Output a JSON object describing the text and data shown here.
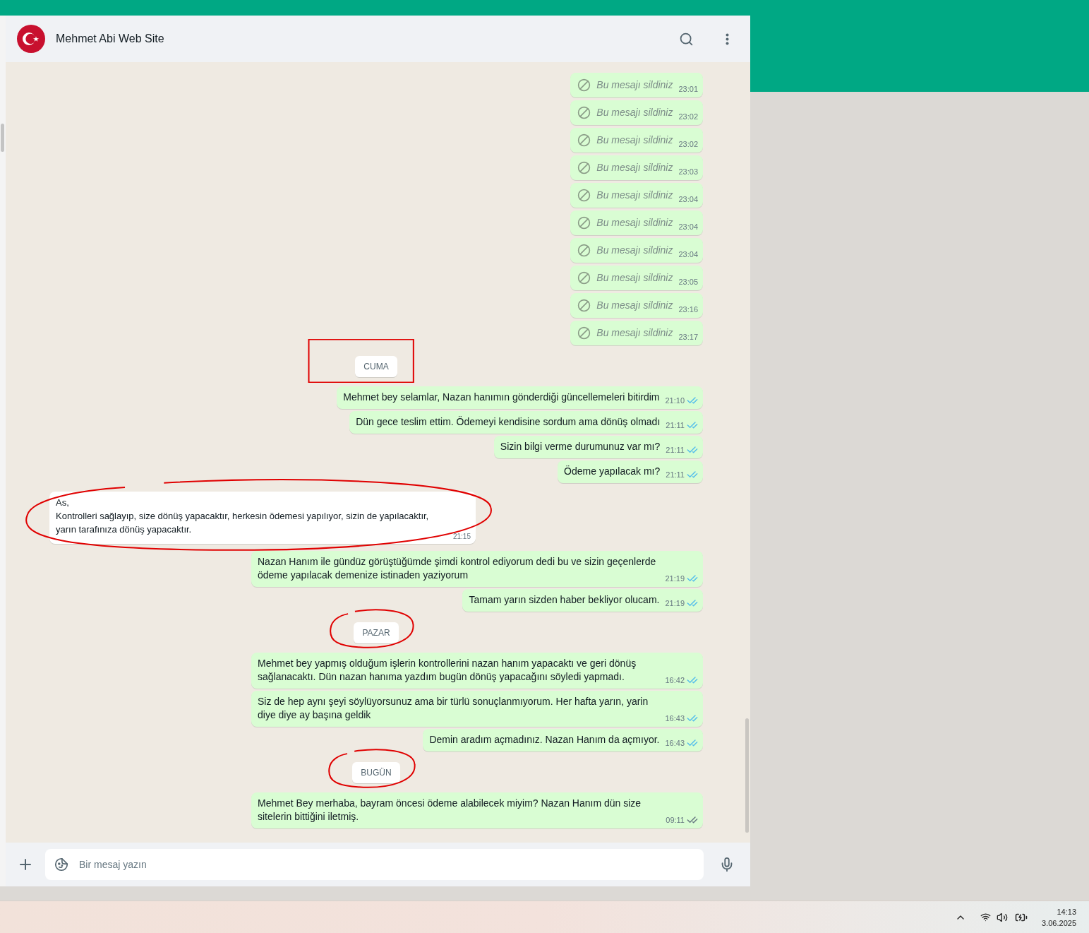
{
  "header": {
    "title": "Mehmet Abi Web Site"
  },
  "messages": [
    {
      "kind": "deleted",
      "text": "Bu mesajı sildiniz",
      "time": "23:01"
    },
    {
      "kind": "deleted",
      "text": "Bu mesajı sildiniz",
      "time": "23:02"
    },
    {
      "kind": "deleted",
      "text": "Bu mesajı sildiniz",
      "time": "23:02"
    },
    {
      "kind": "deleted",
      "text": "Bu mesajı sildiniz",
      "time": "23:03"
    },
    {
      "kind": "deleted",
      "text": "Bu mesajı sildiniz",
      "time": "23:04"
    },
    {
      "kind": "deleted",
      "text": "Bu mesajı sildiniz",
      "time": "23:04"
    },
    {
      "kind": "deleted",
      "text": "Bu mesajı sildiniz",
      "time": "23:04"
    },
    {
      "kind": "deleted",
      "text": "Bu mesajı sildiniz",
      "time": "23:05"
    },
    {
      "kind": "deleted",
      "text": "Bu mesajı sildiniz",
      "time": "23:16"
    },
    {
      "kind": "deleted",
      "text": "Bu mesajı sildiniz",
      "time": "23:17"
    },
    {
      "kind": "date",
      "text": "CUMA",
      "boxed": true,
      "circled": false
    },
    {
      "kind": "out",
      "text": "Mehmet bey selamlar, Nazan hanımın gönderdiği güncellemeleri bitirdim",
      "time": "21:10",
      "read": true
    },
    {
      "kind": "out",
      "text": "Dün gece teslim ettim. Ödemeyi kendisine sordum ama dönüş olmadı",
      "time": "21:11",
      "read": true
    },
    {
      "kind": "out",
      "text": "Sizin bilgi verme durumunuz var mı?",
      "time": "21:11",
      "read": true
    },
    {
      "kind": "out",
      "text": "Ödeme yapılacak mı?",
      "time": "21:11",
      "read": true
    },
    {
      "kind": "in",
      "text": "As,\nKontrolleri sağlayıp, size dönüş yapacaktır, herkesin ödemesi yapılıyor, sizin de yapılacaktır,\nyarın tarafınıza dönüş yapacaktır.",
      "time": "21:15",
      "boxed": false,
      "circled": true
    },
    {
      "kind": "out",
      "text": "Nazan Hanım ile gündüz görüştüğümde şimdi kontrol ediyorum dedi bu ve sizin geçenlerde ödeme yapılacak demenize istinaden yaziyorum",
      "time": "21:19",
      "read": true
    },
    {
      "kind": "out",
      "text": "Tamam yarın sizden haber bekliyor olucam.",
      "time": "21:19",
      "read": true
    },
    {
      "kind": "date",
      "text": "PAZAR",
      "boxed": false,
      "circled": true
    },
    {
      "kind": "out",
      "text": "Mehmet bey yapmış olduğum işlerin kontrollerini nazan hanım yapacaktı ve geri dönüş sağlanacaktı. Dün nazan hanıma yazdım bugün dönüş yapacağını söyledi yapmadı.",
      "time": "16:42",
      "read": true
    },
    {
      "kind": "out",
      "text": "Siz de hep aynı şeyi söylüyorsunuz ama bir türlü sonuçlanmıyorum. Her hafta yarın, yarin diye diye ay başına geldik",
      "time": "16:43",
      "read": true
    },
    {
      "kind": "out",
      "text": "Demin aradım açmadınız. Nazan Hanım da açmıyor.",
      "time": "16:43",
      "read": true
    },
    {
      "kind": "date",
      "text": "BUGÜN",
      "boxed": false,
      "circled": true
    },
    {
      "kind": "out",
      "text": "Mehmet Bey merhaba, bayram öncesi ödeme alabilecek miyim? Nazan Hanım dün size sitelerin bittiğini iletmiş.",
      "time": "09:11",
      "read": false
    }
  ],
  "composer": {
    "placeholder": "Bir mesaj yazın"
  },
  "taskbar": {
    "time": "14:13",
    "date": "3.06.2025"
  }
}
